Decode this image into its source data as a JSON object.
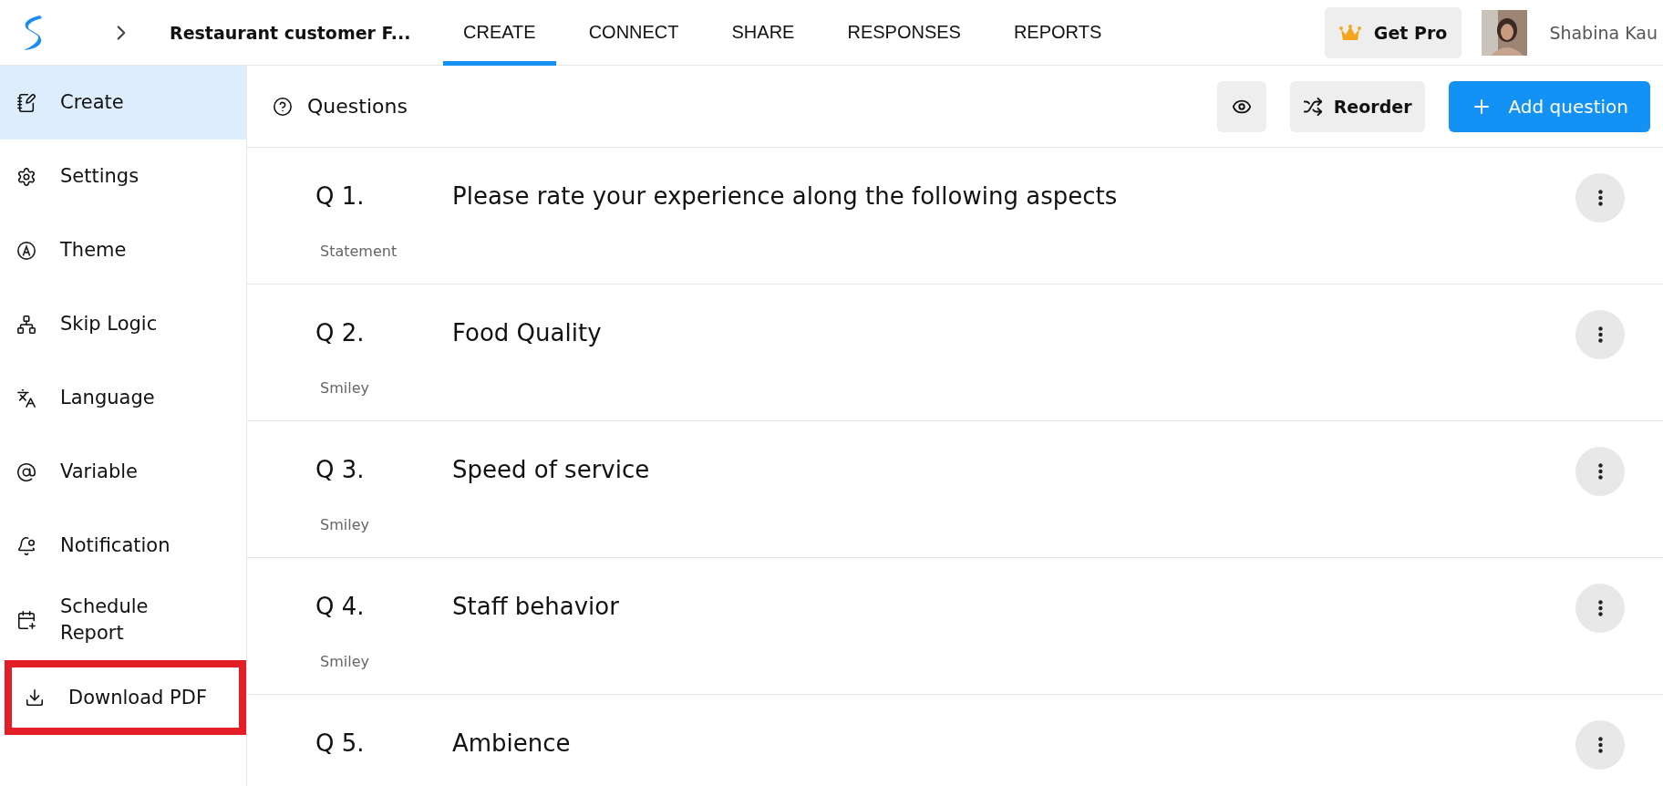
{
  "header": {
    "breadcrumb_title": "Restaurant customer F...",
    "tabs": [
      {
        "label": "CREATE",
        "selected": true
      },
      {
        "label": "CONNECT",
        "selected": false
      },
      {
        "label": "SHARE",
        "selected": false
      },
      {
        "label": "RESPONSES",
        "selected": false
      },
      {
        "label": "REPORTS",
        "selected": false
      }
    ],
    "upgrade_button": "Get Pro",
    "user_name": "Shabina Kau"
  },
  "sidebar": {
    "items": [
      {
        "label": "Create",
        "selected": true,
        "highlighted": false
      },
      {
        "label": "Settings",
        "selected": false,
        "highlighted": false
      },
      {
        "label": "Theme",
        "selected": false,
        "highlighted": false
      },
      {
        "label": "Skip Logic",
        "selected": false,
        "highlighted": false
      },
      {
        "label": "Language",
        "selected": false,
        "highlighted": false
      },
      {
        "label": "Variable",
        "selected": false,
        "highlighted": false
      },
      {
        "label": "Notification",
        "selected": false,
        "highlighted": false
      },
      {
        "label": "Schedule Report",
        "selected": false,
        "highlighted": false
      },
      {
        "label": "Download PDF",
        "selected": false,
        "highlighted": true
      }
    ]
  },
  "toolbar": {
    "title": "Questions",
    "reorder_button": "Reorder",
    "add_button": "Add question"
  },
  "questions": [
    {
      "number": "Q 1.",
      "title": "Please rate your experience along the following aspects",
      "type": "Statement"
    },
    {
      "number": "Q 2.",
      "title": "Food Quality",
      "type": "Smiley"
    },
    {
      "number": "Q 3.",
      "title": "Speed of service",
      "type": "Smiley"
    },
    {
      "number": "Q 4.",
      "title": "Staff behavior",
      "type": "Smiley"
    },
    {
      "number": "Q 5.",
      "title": "Ambience"
    }
  ]
}
